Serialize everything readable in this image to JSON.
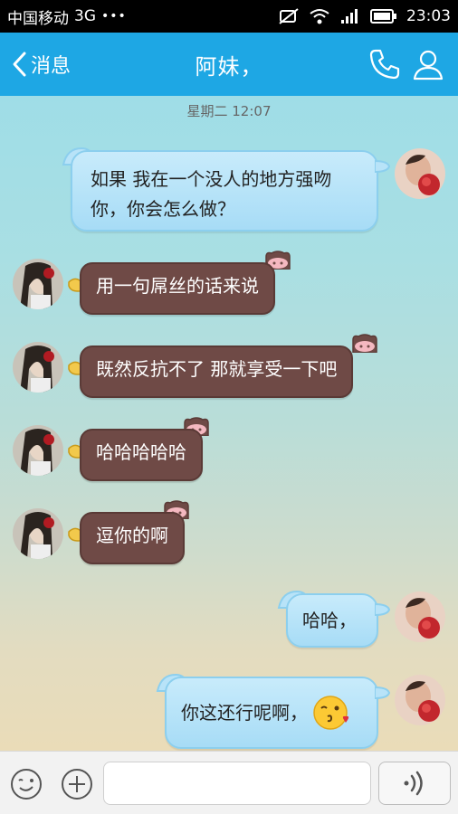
{
  "status": {
    "carrier": "中国移动",
    "network": "3G",
    "dots": "•••",
    "time": "23:03"
  },
  "header": {
    "back_label": "消息",
    "title": "阿妹，"
  },
  "chat": {
    "timestamp": "星期二 12:07",
    "messages": [
      {
        "side": "right",
        "style": "blue",
        "line1": "如果 我在一个没人的地方强吻",
        "line2": "你，你会怎么做？"
      },
      {
        "side": "left",
        "style": "brown",
        "text": "用一句屌丝的话来说"
      },
      {
        "side": "left",
        "style": "brown",
        "text": "既然反抗不了 那就享受一下吧"
      },
      {
        "side": "left",
        "style": "brown",
        "text": "哈哈哈哈哈"
      },
      {
        "side": "left",
        "style": "brown",
        "text": "逗你的啊"
      },
      {
        "side": "right",
        "style": "blue",
        "text": "哈哈，"
      },
      {
        "side": "right",
        "style": "blue",
        "text": "你这还行呢啊，",
        "emoji": "kiss-face"
      }
    ]
  },
  "input": {
    "placeholder": ""
  },
  "colors": {
    "header_bg": "#1ea7e4",
    "blue_bubble": "#b8e3f8",
    "brown_bubble": "#6f4a46"
  }
}
